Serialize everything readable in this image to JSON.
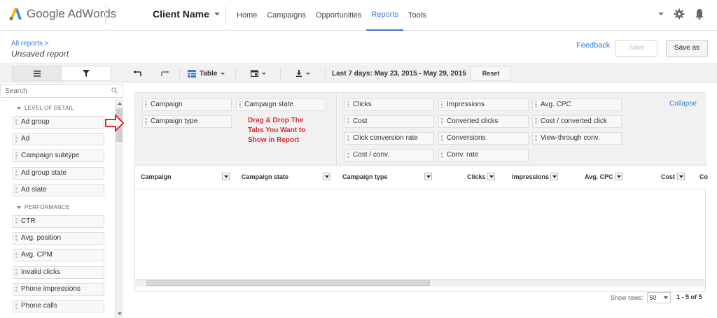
{
  "app": {
    "logo_text": "Google AdWords",
    "client_name": "Client Name",
    "nav": [
      "Home",
      "Campaigns",
      "Opportunities",
      "Reports",
      "Tools"
    ],
    "active_nav": "Reports",
    "accent_color": "#3b7bd4"
  },
  "report": {
    "breadcrumb": "All reports >",
    "title": "Unsaved report",
    "feedback": "Feedback",
    "save": "Save",
    "save_as": "Save as"
  },
  "left": {
    "search_placeholder": "Search",
    "section_detail": "LEVEL OF DETAIL",
    "detail_fields": [
      "Ad group",
      "Ad",
      "Campaign subtype",
      "Ad group state",
      "Ad state"
    ],
    "section_performance": "PERFORMANCE",
    "performance_fields": [
      "CTR",
      "Avg. position",
      "Avg. CPM",
      "Invalid clicks",
      "Phone impressions",
      "Phone calls"
    ]
  },
  "toolbar": {
    "view": "Table",
    "date_range": "Last 7 days: May 23, 2015 - May 29, 2015",
    "reset": "Reset"
  },
  "dimensions": [
    "Campaign",
    "Campaign state",
    "Campaign type"
  ],
  "metrics": [
    [
      "Clicks",
      "Impressions",
      "Avg. CPC"
    ],
    [
      "Cost",
      "Converted clicks",
      "Cost / converted click"
    ],
    [
      "Click conversion rate",
      "Conversions",
      "View-through conv."
    ],
    [
      "Cost / conv.",
      "Conv. rate"
    ]
  ],
  "collapse": "Collapse",
  "annotation": [
    "Drag & Drop The",
    "Tabs You Want to",
    "Show in Report"
  ],
  "columns": [
    "Campaign",
    "Campaign state",
    "Campaign type",
    "Clicks",
    "Impressions",
    "Avg. CPC",
    "Cost",
    "Co"
  ],
  "footer": {
    "show_rows_label": "Show rows:",
    "rows_value": "50",
    "range": "1 - 5 of 5"
  }
}
